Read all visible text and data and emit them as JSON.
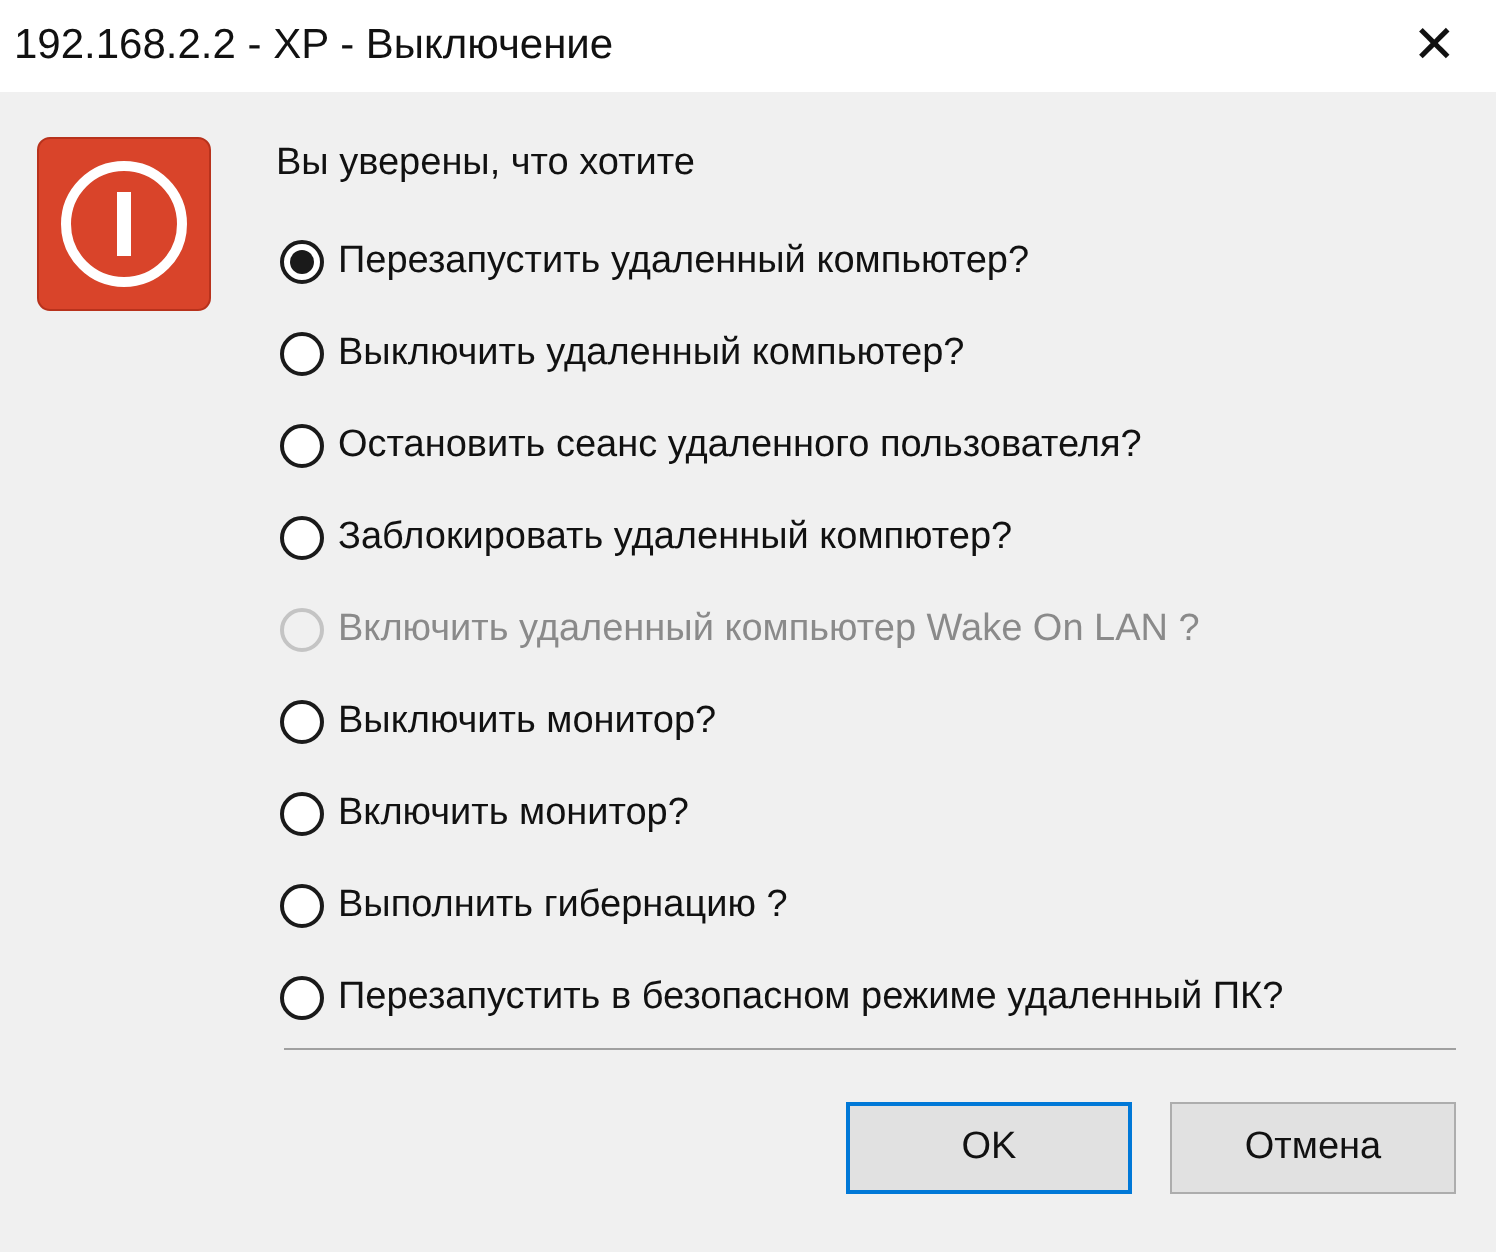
{
  "window": {
    "title": "192.168.2.2 - XP - Выключение",
    "close": "✕"
  },
  "prompt": "Вы уверены, что хотите",
  "options": [
    {
      "label": "Перезапустить удаленный компьютер?",
      "selected": true,
      "disabled": false
    },
    {
      "label": "Выключить удаленный компьютер?",
      "selected": false,
      "disabled": false
    },
    {
      "label": "Остановить сеанс удаленного пользователя?",
      "selected": false,
      "disabled": false
    },
    {
      "label": "Заблокировать удаленный компютер?",
      "selected": false,
      "disabled": false
    },
    {
      "label": "Включить удаленный компьютер Wake On LAN ?",
      "selected": false,
      "disabled": true
    },
    {
      "label": "Выключить монитор?",
      "selected": false,
      "disabled": false
    },
    {
      "label": "Включить монитор?",
      "selected": false,
      "disabled": false
    },
    {
      "label": "Выполнить гибернацию ?",
      "selected": false,
      "disabled": false
    },
    {
      "label": "Перезапустить в безопасном режиме удаленный ПК?",
      "selected": false,
      "disabled": false
    }
  ],
  "buttons": [
    {
      "label": "OK",
      "default": true
    },
    {
      "label": "Отмена",
      "default": false
    }
  ]
}
